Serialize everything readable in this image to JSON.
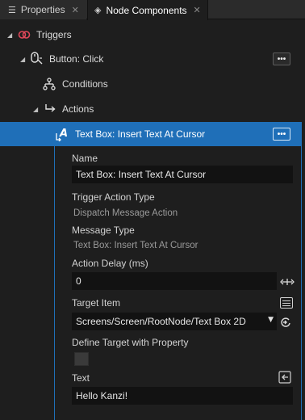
{
  "tabs": [
    {
      "label": "Properties",
      "icon": "list-icon",
      "close": "✕"
    },
    {
      "label": "Node Components",
      "icon": "node-components-icon",
      "close": "✕"
    }
  ],
  "tree": {
    "triggers": {
      "label": "Triggers",
      "icon": "triggers-icon"
    },
    "button_click": {
      "label": "Button: Click",
      "icon": "click-trigger-icon",
      "menu": "•••"
    },
    "conditions": {
      "label": "Conditions",
      "icon": "conditions-icon"
    },
    "actions": {
      "label": "Actions",
      "icon": "actions-icon"
    },
    "action_item": {
      "label": "Text Box: Insert Text At Cursor",
      "icon": "text-action-icon",
      "menu": "•••",
      "selected": true
    }
  },
  "properties": {
    "name": {
      "label": "Name",
      "value": "Text Box: Insert Text At Cursor"
    },
    "trigger_action_type": {
      "label": "Trigger Action Type",
      "value": "Dispatch Message Action"
    },
    "message_type": {
      "label": "Message Type",
      "value": "Text Box: Insert Text At Cursor"
    },
    "action_delay": {
      "label": "Action Delay (ms)",
      "value": "0"
    },
    "target_item": {
      "label": "Target Item",
      "value": "Screens/Screen/RootNode/Text Box 2D"
    },
    "define_target": {
      "label": "Define Target with Property",
      "checked": false
    },
    "text": {
      "label": "Text",
      "value": "Hello Kanzi!"
    }
  },
  "colors": {
    "selection": "#1f6fb8",
    "background": "#1e1e1e",
    "field": "#121212",
    "trigger_icon": "#e0485a"
  }
}
